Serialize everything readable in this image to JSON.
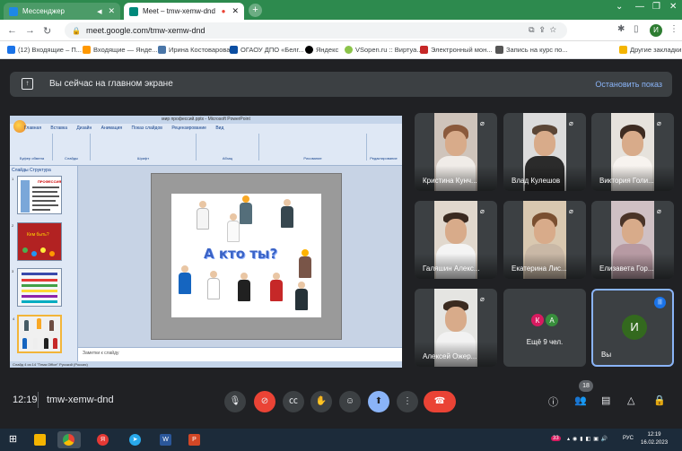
{
  "browser": {
    "tabs": [
      {
        "label": "Мессенджер",
        "fav_color": "#1e88e5"
      },
      {
        "label": "Meet – tmw-xemw-dnd",
        "fav_color": "#00897b"
      }
    ],
    "url": "meet.google.com/tmw-xemw-dnd",
    "profile_initial": "И",
    "bookmarks": [
      {
        "label": "(12) Входящие – П...",
        "color": "#1a73e8"
      },
      {
        "label": "Входящие — Янде...",
        "color": "#ff9800"
      },
      {
        "label": "Ирина Костоварова",
        "color": "#4a76a8"
      },
      {
        "label": "ОГАОУ ДПО «Белг...",
        "color": "#0b4ea2"
      },
      {
        "label": "Яндекс",
        "color": "#000000"
      },
      {
        "label": "VSopen.ru :: Виртуа...",
        "color": "#8bc34a"
      },
      {
        "label": "Электронный мон...",
        "color": "#c62828"
      },
      {
        "label": "Запись на курс по...",
        "color": "#555555"
      }
    ],
    "other_bookmarks": "Другие закладки"
  },
  "banner": {
    "text": "Вы сейчас на главном экране",
    "stop_label": "Остановить показ"
  },
  "presentation": {
    "window_title": "мир профессий.pptx - Microsoft PowerPoint",
    "ribbon_tabs": [
      "Главная",
      "Вставка",
      "Дизайн",
      "Анимация",
      "Показ слайдов",
      "Рецензирование",
      "Вид"
    ],
    "ribbon_groups": [
      "Буфер обмена",
      "Слайды",
      "Шрифт",
      "Абзац",
      "Рисование",
      "Редактирование"
    ],
    "pane_tabs": "Слайды  Структура",
    "thumb1_title": "ПРОФЕССИЯ",
    "thumb2_title": "Кем быть?",
    "slide_heading": "А кто ты?",
    "notes_placeholder": "Заметки к слайду",
    "status": "Слайд 4 из 14    \"Тема Office\"    Русский (Россия)",
    "thumb_numbers": [
      "1",
      "2",
      "3",
      "4"
    ]
  },
  "participants": [
    {
      "name": "Кристина Кунч...",
      "muted": true
    },
    {
      "name": "Влад Кулешов",
      "muted": true
    },
    {
      "name": "Виктория Голи...",
      "muted": true
    },
    {
      "name": "Галяшин Алекс...",
      "muted": true
    },
    {
      "name": "Екатерина Лис...",
      "muted": true
    },
    {
      "name": "Елизавета Гор...",
      "muted": true
    },
    {
      "name": "Алексей Ожер...",
      "muted": true
    }
  ],
  "more_tile": {
    "label": "Ещё 9 чел.",
    "avatars": [
      {
        "initial": "К",
        "color": "#d81b60"
      },
      {
        "initial": "А",
        "color": "#388e3c"
      }
    ]
  },
  "self_tile": {
    "label": "Вы",
    "initial": "И"
  },
  "meeting": {
    "time": "12:19",
    "code": "tmw-xemw-dnd",
    "people_count": "18"
  },
  "taskbar": {
    "time": "12:19",
    "date": "16.02.2023",
    "lang": "РУС",
    "notif_count": "33"
  },
  "colors": {
    "meet_bg": "#202124",
    "tile_bg": "#3c4043",
    "accent_blue": "#8ab4f8",
    "hangup_red": "#ea4335"
  }
}
